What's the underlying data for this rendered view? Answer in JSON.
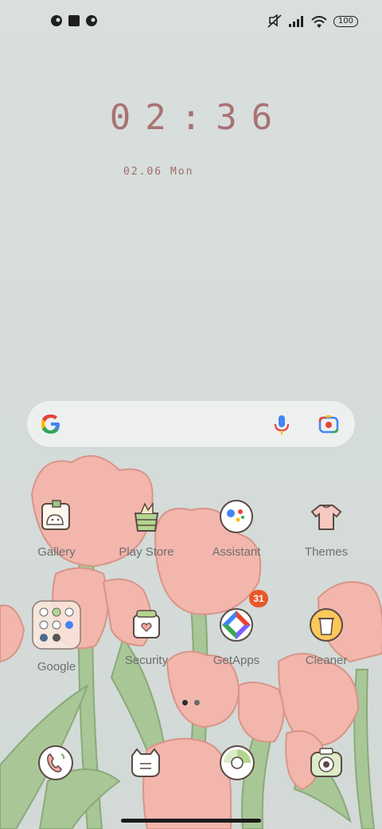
{
  "status_bar": {
    "battery": "100",
    "icons": [
      "notification-app-icon",
      "notification-square-icon",
      "notification-app-icon-2",
      "silent-icon",
      "signal-icon",
      "wifi-icon",
      "battery-icon"
    ]
  },
  "clock": {
    "time": "02:36",
    "date": "02.06 Mon"
  },
  "search_bar": {
    "icons": [
      "google-logo-icon",
      "microphone-icon",
      "lens-camera-icon"
    ]
  },
  "apps": [
    {
      "label": "Gallery",
      "icon": "gallery-icon"
    },
    {
      "label": "Play Store",
      "icon": "play-store-icon"
    },
    {
      "label": "Assistant",
      "icon": "assistant-icon"
    },
    {
      "label": "Themes",
      "icon": "themes-icon"
    },
    {
      "label": "Google",
      "icon": "google-folder-icon"
    },
    {
      "label": "Security",
      "icon": "security-icon"
    },
    {
      "label": "GetApps",
      "icon": "getapps-icon",
      "badge": "31"
    },
    {
      "label": "Cleaner",
      "icon": "cleaner-icon"
    }
  ],
  "dock": [
    {
      "icon": "phone-icon"
    },
    {
      "icon": "messages-icon"
    },
    {
      "icon": "browser-icon"
    },
    {
      "icon": "camera-icon"
    }
  ],
  "page_indicator": {
    "pages": 2,
    "current": 1
  },
  "colors": {
    "clock": "#a87272",
    "badge": "#e8582a",
    "tulip": "#f2b6ad",
    "stem": "#a9c796"
  }
}
